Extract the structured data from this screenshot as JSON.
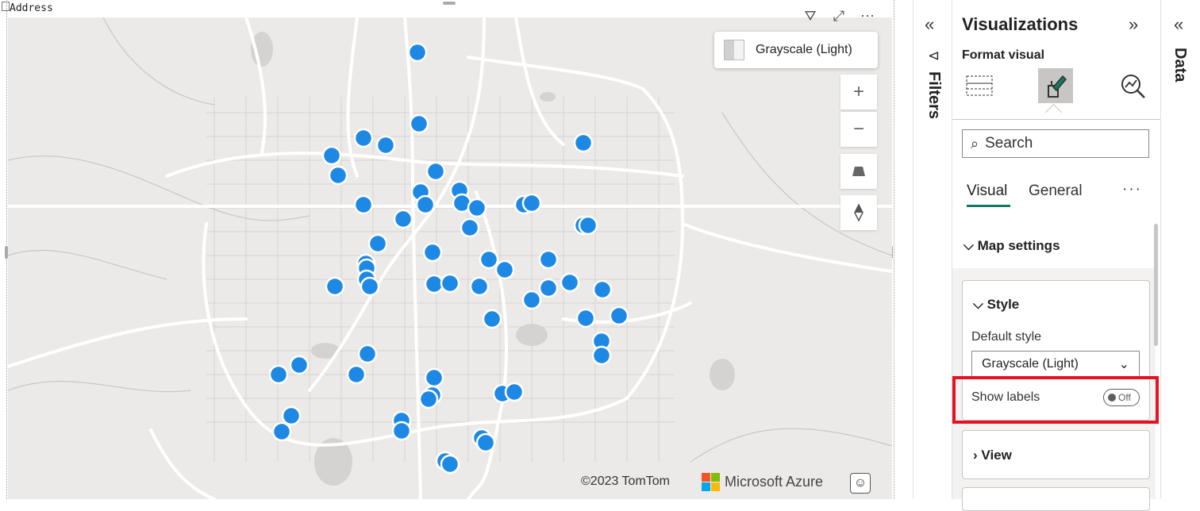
{
  "map": {
    "field_label": "Address",
    "style_pill_label": "Grayscale (Light)",
    "attribution": "©2023 TomTom",
    "brand": "Microsoft Azure",
    "marker_color": "#1e88e5",
    "controls": {
      "zoom_in": "+",
      "zoom_out": "−",
      "pitch": "pitch-icon",
      "compass": "compass-icon"
    },
    "header_icons": [
      "filter-icon",
      "focus-mode-icon",
      "more-options-icon"
    ]
  },
  "filters_pane": {
    "label": "Filters"
  },
  "visualizations": {
    "title": "Visualizations",
    "format_label": "Format visual",
    "search_placeholder": "Search",
    "tabs": [
      "Visual",
      "General"
    ],
    "more": "···",
    "section_map_settings": "Map settings",
    "style_card": {
      "title": "Style",
      "default_style_label": "Default style",
      "default_style_value": "Grayscale (Light)",
      "show_labels_label": "Show labels",
      "show_labels_value": "Off"
    },
    "view_card": {
      "title": "View"
    }
  },
  "data_pane": {
    "label": "Data"
  }
}
